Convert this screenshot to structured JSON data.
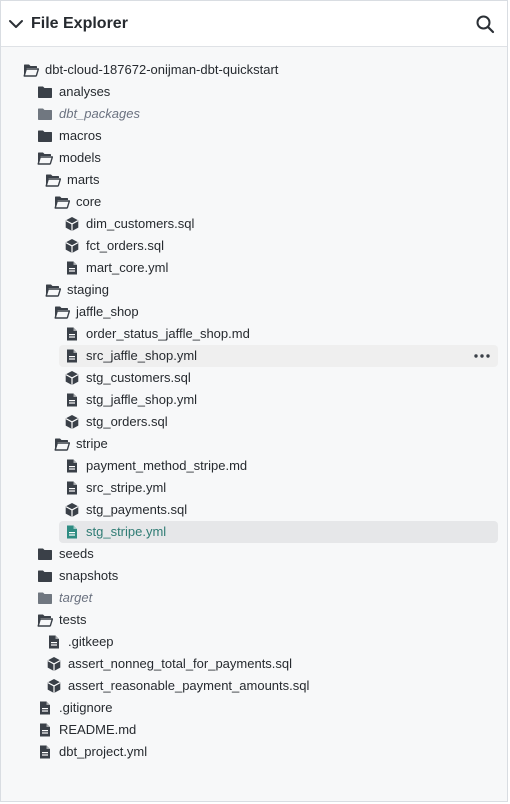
{
  "header": {
    "title": "File Explorer",
    "collapse_icon": "chevron-down-icon",
    "search_icon": "search-icon"
  },
  "colors": {
    "icon": "#3a4048",
    "icon_muted": "#707780",
    "selected_text": "#2f7c74",
    "selected_icon": "#2f8c82"
  },
  "tree": {
    "root": "dbt-cloud-187672-onijman-dbt-quickstart",
    "analyses": "analyses",
    "dbt_packages": "dbt_packages",
    "macros": "macros",
    "models": "models",
    "marts": "marts",
    "core": "core",
    "dim_customers": "dim_customers.sql",
    "fct_orders": "fct_orders.sql",
    "mart_core": "mart_core.yml",
    "staging": "staging",
    "jaffle_shop": "jaffle_shop",
    "order_status": "order_status_jaffle_shop.md",
    "src_jaffle_shop": "src_jaffle_shop.yml",
    "stg_customers": "stg_customers.sql",
    "stg_jaffle_shop": "stg_jaffle_shop.yml",
    "stg_orders": "stg_orders.sql",
    "stripe": "stripe",
    "payment_method": "payment_method_stripe.md",
    "src_stripe": "src_stripe.yml",
    "stg_payments": "stg_payments.sql",
    "stg_stripe": "stg_stripe.yml",
    "seeds": "seeds",
    "snapshots": "snapshots",
    "target": "target",
    "tests": "tests",
    "gitkeep": ".gitkeep",
    "assert_nonneg": "assert_nonneg_total_for_payments.sql",
    "assert_reasonable": "assert_reasonable_payment_amounts.sql",
    "gitignore": ".gitignore",
    "readme": "README.md",
    "dbt_project": "dbt_project.yml"
  },
  "row_actions": {
    "more_icon": "more-horizontal-icon"
  }
}
